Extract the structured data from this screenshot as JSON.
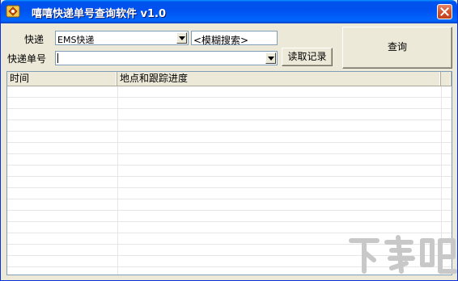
{
  "window": {
    "title": "嘻嘻快递单号查询软件 v1.0",
    "icons": {
      "app": "app-logo-icon",
      "close": "close-icon"
    }
  },
  "form": {
    "courier_label": "快递",
    "courier_value": "EMS快递",
    "fuzzy_search_value": "<模糊搜索>",
    "tracking_label": "快递单号",
    "tracking_value": "",
    "read_records_label": "读取记录",
    "query_label": "查询"
  },
  "table": {
    "columns": [
      "时间",
      "地点和跟踪进度"
    ],
    "rows": []
  },
  "watermark": {
    "text": "下载吧"
  }
}
